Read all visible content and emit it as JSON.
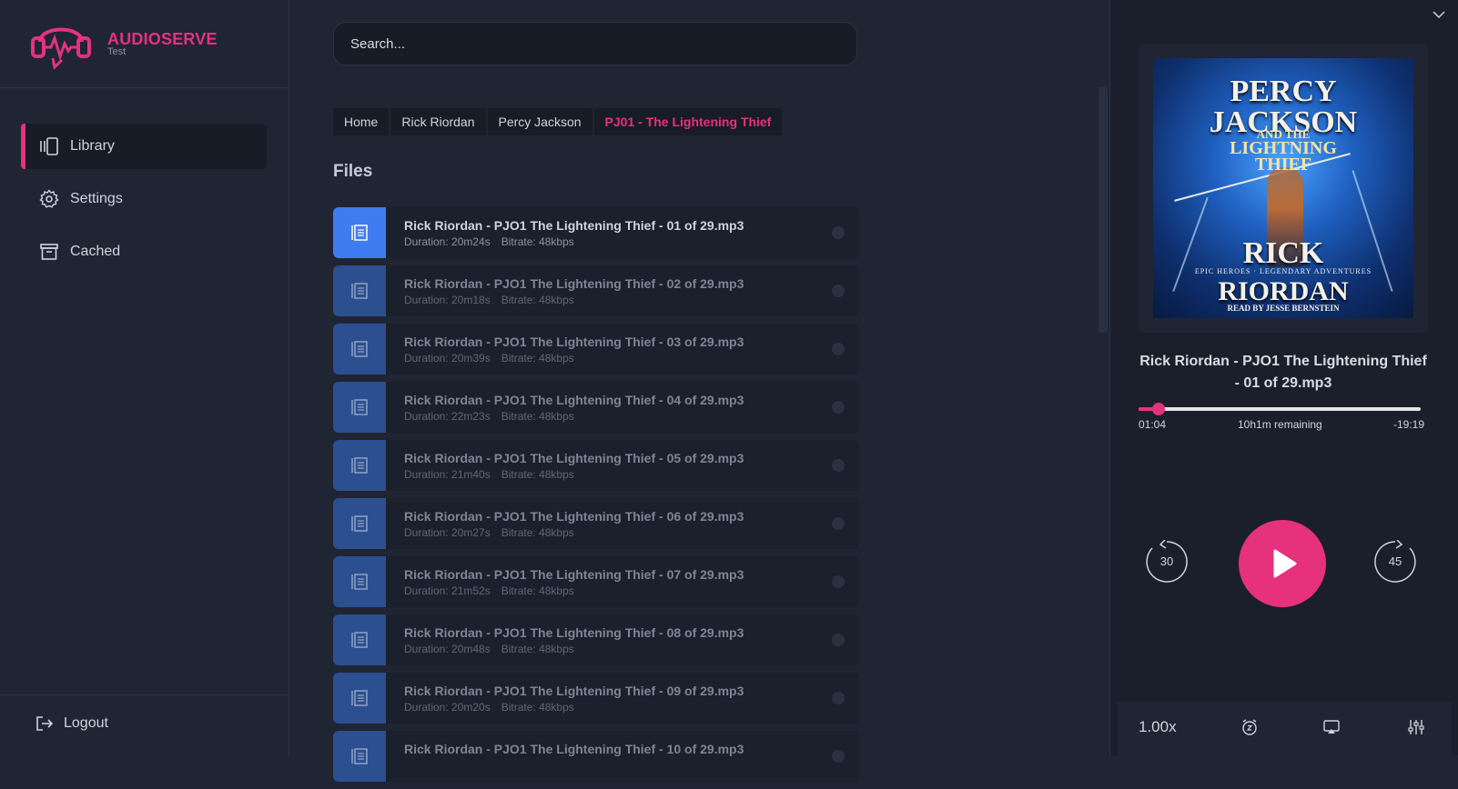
{
  "brand": {
    "name": "AUDIOSERVE",
    "subtitle": "Test"
  },
  "nav": {
    "items": [
      {
        "label": "Library",
        "icon": "library-icon",
        "active": true
      },
      {
        "label": "Settings",
        "icon": "gear-icon",
        "active": false
      },
      {
        "label": "Cached",
        "icon": "archive-icon",
        "active": false
      }
    ],
    "logout_label": "Logout"
  },
  "search": {
    "placeholder": "Search..."
  },
  "breadcrumbs": [
    "Home",
    "Rick Riordan",
    "Percy Jackson",
    "PJ01 - The Lightening Thief"
  ],
  "files_title": "Files",
  "files": [
    {
      "name": "Rick Riordan - PJO1 The Lightening Thief - 01 of 29.mp3",
      "duration": "Duration: 20m24s",
      "bitrate": "Bitrate: 48kbps"
    },
    {
      "name": "Rick Riordan - PJO1 The Lightening Thief - 02 of 29.mp3",
      "duration": "Duration: 20m18s",
      "bitrate": "Bitrate: 48kbps"
    },
    {
      "name": "Rick Riordan - PJO1 The Lightening Thief - 03 of 29.mp3",
      "duration": "Duration: 20m39s",
      "bitrate": "Bitrate: 48kbps"
    },
    {
      "name": "Rick Riordan - PJO1 The Lightening Thief - 04 of 29.mp3",
      "duration": "Duration: 22m23s",
      "bitrate": "Bitrate: 48kbps"
    },
    {
      "name": "Rick Riordan - PJO1 The Lightening Thief - 05 of 29.mp3",
      "duration": "Duration: 21m40s",
      "bitrate": "Bitrate: 48kbps"
    },
    {
      "name": "Rick Riordan - PJO1 The Lightening Thief - 06 of 29.mp3",
      "duration": "Duration: 20m27s",
      "bitrate": "Bitrate: 48kbps"
    },
    {
      "name": "Rick Riordan - PJO1 The Lightening Thief - 07 of 29.mp3",
      "duration": "Duration: 21m52s",
      "bitrate": "Bitrate: 48kbps"
    },
    {
      "name": "Rick Riordan - PJO1 The Lightening Thief - 08 of 29.mp3",
      "duration": "Duration: 20m48s",
      "bitrate": "Bitrate: 48kbps"
    },
    {
      "name": "Rick Riordan - PJO1 The Lightening Thief - 09 of 29.mp3",
      "duration": "Duration: 20m20s",
      "bitrate": "Bitrate: 48kbps"
    },
    {
      "name": "Rick Riordan - PJO1 The Lightening Thief - 10 of 29.mp3",
      "duration": "",
      "bitrate": ""
    }
  ],
  "player": {
    "cover": {
      "title_line1": "PERCY",
      "title_line2": "JACKSON",
      "title_line3": "AND THE",
      "title_line4": "LIGHTNING",
      "title_line5": "THIEF",
      "author_line1": "RICK",
      "tagline": "EPIC HEROES · LEGENDARY ADVENTURES",
      "author_line2": "RIORDAN",
      "narrator": "READ BY JESSE BERNSTEIN"
    },
    "track_title": "Rick Riordan - PJO1 The Lightening Thief - 01 of 29.mp3",
    "elapsed": "01:04",
    "remaining_total": "10h1m remaining",
    "remaining_track": "-19:19",
    "progress_fraction": 0.07,
    "rewind_seconds": "30",
    "forward_seconds": "45",
    "speed": "1.00x"
  },
  "colors": {
    "accent": "#e6317d",
    "active_thumb": "#3f7cf2",
    "thumb": "#2c4f8f",
    "background": "#1f2533"
  }
}
